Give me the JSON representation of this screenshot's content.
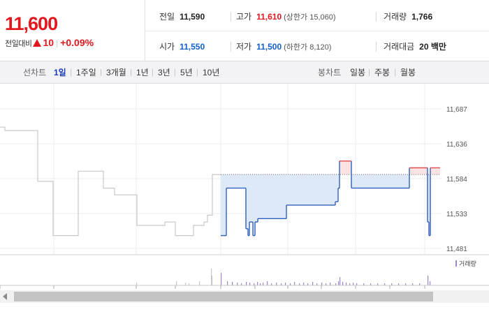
{
  "summary": {
    "price": "11,600",
    "change_label": "전일대비",
    "change_value": "10",
    "change_pct": "+0.09%",
    "prev_close": {
      "label": "전일",
      "value": "11,590"
    },
    "high": {
      "label": "고가",
      "value": "11,610",
      "sub": "(상한가 15,060)"
    },
    "volume": {
      "label": "거래량",
      "value": "1,766"
    },
    "open": {
      "label": "시가",
      "value": "11,550"
    },
    "low": {
      "label": "저가",
      "value": "11,500",
      "sub": "(하한가 8,120)"
    },
    "turnover": {
      "label": "거래대금",
      "value": "20 백만"
    }
  },
  "toolbar": {
    "line_label": "선차트",
    "line_periods": [
      "1일",
      "1주일",
      "3개월",
      "1년",
      "3년",
      "5년",
      "10년"
    ],
    "active_period": "1일",
    "candle_label": "봉차트",
    "candle_periods": [
      "일봉",
      "주봉",
      "월봉"
    ]
  },
  "chart_data": {
    "type": "line",
    "y_ticks": [
      "11,687",
      "11,636",
      "11,584",
      "11,533",
      "11,481"
    ],
    "ylim": [
      11481,
      11687
    ],
    "reference": 11590,
    "prev_series": [
      [
        0,
        11660
      ],
      [
        7,
        11660
      ],
      [
        7,
        11655
      ],
      [
        54,
        11655
      ],
      [
        54,
        11580
      ],
      [
        76,
        11580
      ],
      [
        76,
        11500
      ],
      [
        112,
        11500
      ],
      [
        112,
        11595
      ],
      [
        148,
        11595
      ],
      [
        148,
        11570
      ],
      [
        164,
        11570
      ],
      [
        164,
        11560
      ],
      [
        196,
        11560
      ],
      [
        196,
        11515
      ],
      [
        236,
        11515
      ],
      [
        236,
        11520
      ],
      [
        251,
        11520
      ],
      [
        251,
        11500
      ],
      [
        277,
        11500
      ],
      [
        277,
        11515
      ],
      [
        292,
        11515
      ],
      [
        292,
        11520
      ],
      [
        297,
        11520
      ],
      [
        297,
        11530
      ],
      [
        304,
        11530
      ],
      [
        304,
        11590
      ],
      [
        316,
        11590
      ]
    ],
    "today_series": [
      [
        316,
        11500
      ],
      [
        324,
        11500
      ],
      [
        324,
        11570
      ],
      [
        352,
        11570
      ],
      [
        352,
        11510
      ],
      [
        355,
        11510
      ],
      [
        355,
        11500
      ],
      [
        357,
        11500
      ],
      [
        357,
        11520
      ],
      [
        362,
        11520
      ],
      [
        362,
        11500
      ],
      [
        365,
        11500
      ],
      [
        365,
        11520
      ],
      [
        369,
        11520
      ],
      [
        369,
        11525
      ],
      [
        410,
        11525
      ],
      [
        410,
        11545
      ],
      [
        480,
        11545
      ],
      [
        480,
        11550
      ],
      [
        484,
        11550
      ],
      [
        484,
        11570
      ],
      [
        486,
        11570
      ],
      [
        486,
        11610
      ],
      [
        503,
        11610
      ],
      [
        503,
        11570
      ],
      [
        586,
        11570
      ],
      [
        586,
        11600
      ],
      [
        612,
        11600
      ],
      [
        612,
        11520
      ],
      [
        614,
        11520
      ],
      [
        614,
        11500
      ],
      [
        616,
        11500
      ],
      [
        616,
        11600
      ],
      [
        630,
        11600
      ]
    ],
    "volume_legend": "거래량",
    "volume_bars": [
      [
        195,
        4
      ],
      [
        252,
        6
      ],
      [
        265,
        4
      ],
      [
        270,
        3
      ],
      [
        285,
        6
      ],
      [
        302,
        24
      ],
      [
        303,
        14
      ],
      [
        316,
        18
      ],
      [
        325,
        6
      ],
      [
        332,
        5
      ],
      [
        339,
        4
      ],
      [
        345,
        3
      ],
      [
        352,
        5
      ],
      [
        357,
        4
      ],
      [
        363,
        3
      ],
      [
        368,
        5
      ],
      [
        372,
        3
      ],
      [
        376,
        4
      ],
      [
        382,
        6
      ],
      [
        388,
        3
      ],
      [
        395,
        4
      ],
      [
        402,
        3
      ],
      [
        408,
        4
      ],
      [
        415,
        3
      ],
      [
        421,
        5
      ],
      [
        428,
        3
      ],
      [
        434,
        4
      ],
      [
        440,
        3
      ],
      [
        447,
        5
      ],
      [
        453,
        3
      ],
      [
        460,
        4
      ],
      [
        466,
        3
      ],
      [
        472,
        4
      ],
      [
        480,
        3
      ],
      [
        484,
        6
      ],
      [
        486,
        12
      ],
      [
        490,
        5
      ],
      [
        495,
        4
      ],
      [
        500,
        3
      ],
      [
        505,
        4
      ],
      [
        510,
        3
      ],
      [
        520,
        3
      ],
      [
        530,
        3
      ],
      [
        540,
        3
      ],
      [
        550,
        3
      ],
      [
        560,
        3
      ],
      [
        570,
        3
      ],
      [
        580,
        3
      ],
      [
        590,
        3
      ],
      [
        600,
        3
      ],
      [
        612,
        14
      ],
      [
        615,
        6
      ]
    ],
    "x_ticks": [
      0,
      77,
      195,
      251,
      316,
      365,
      412,
      460,
      509,
      558,
      608
    ]
  }
}
